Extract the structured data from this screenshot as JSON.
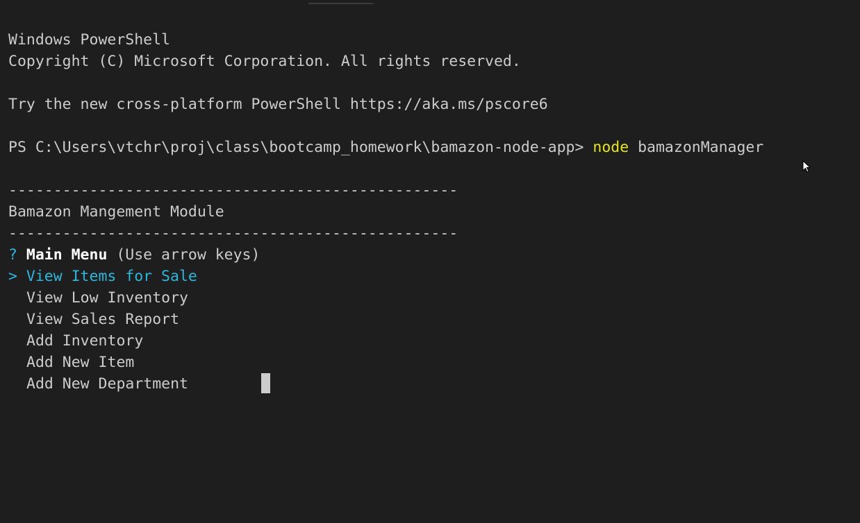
{
  "terminal": {
    "header": {
      "title": "Windows PowerShell",
      "copyright": "Copyright (C) Microsoft Corporation. All rights reserved.",
      "tip": "Try the new cross-platform PowerShell https://aka.ms/pscore6"
    },
    "prompt": {
      "path": "PS C:\\Users\\vtchr\\proj\\class\\bootcamp_homework\\bamazon-node-app> ",
      "command": "node",
      "argument": " bamazonManager"
    },
    "banner": {
      "rule_top": "--------------------------------------------------",
      "title": "Bamazon Mangement Module",
      "rule_bottom": "--------------------------------------------------"
    },
    "menu": {
      "question_mark": "? ",
      "question": "Main Menu",
      "hint": " (Use arrow keys)",
      "pointer": "> ",
      "selected": "View Items for Sale",
      "items": [
        "View Low Inventory",
        "View Sales Report",
        "Add Inventory",
        "Add New Item",
        "Add New Department"
      ]
    }
  },
  "colors": {
    "background": "#1e1e1e",
    "text": "#cccccc",
    "command": "#e5e510",
    "accent": "#29b8db"
  }
}
